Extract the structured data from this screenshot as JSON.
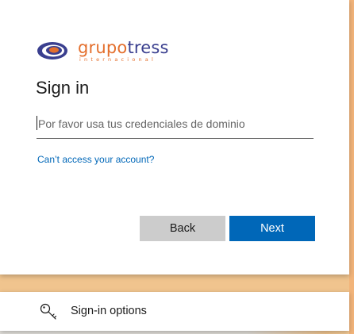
{
  "logo": {
    "brand_part1": "grupo",
    "brand_part2": "tress",
    "subtitle": "internacional"
  },
  "signin": {
    "title": "Sign in",
    "input_placeholder": "Por favor usa tus credenciales de dominio",
    "input_value": "",
    "cant_access_link": "Can’t access your account?"
  },
  "buttons": {
    "back_label": "Back",
    "next_label": "Next"
  },
  "options": {
    "label": "Sign-in options",
    "icon": "key-icon"
  },
  "colors": {
    "accent": "#0067b8",
    "brand_orange": "#e46f2d",
    "brand_blue": "#3a3f8f",
    "back_button": "#cccccc"
  }
}
